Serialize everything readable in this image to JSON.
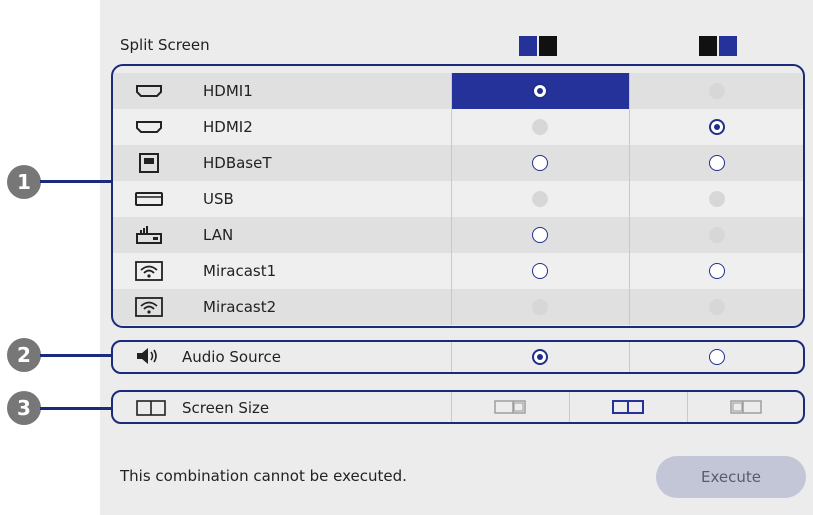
{
  "header": {
    "title": "Split Screen",
    "left_layout_icon": "left-active-layout-icon",
    "right_layout_icon": "right-active-layout-icon"
  },
  "sources": [
    {
      "label": "HDMI1",
      "icon": "hdmi-icon",
      "left": "selected",
      "right": "disabled"
    },
    {
      "label": "HDMI2",
      "icon": "hdmi-icon",
      "left": "disabled",
      "right": "checked"
    },
    {
      "label": "HDBaseT",
      "icon": "hdbaset-icon",
      "left": "unchecked",
      "right": "unchecked"
    },
    {
      "label": "USB",
      "icon": "usb-icon",
      "left": "disabled",
      "right": "disabled"
    },
    {
      "label": "LAN",
      "icon": "lan-icon",
      "left": "unchecked",
      "right": "disabled"
    },
    {
      "label": "Miracast1",
      "icon": "wifi-icon",
      "left": "unchecked",
      "right": "unchecked"
    },
    {
      "label": "Miracast2",
      "icon": "wifi-icon",
      "left": "disabled",
      "right": "disabled"
    }
  ],
  "audio": {
    "label": "Audio Source",
    "icon": "speaker-icon",
    "left": "checked",
    "right": "unchecked"
  },
  "screen_size": {
    "label": "Screen Size",
    "icon": "screen-size-icon",
    "options": [
      "left-large",
      "equal",
      "right-large"
    ],
    "selected": "equal"
  },
  "callouts": [
    "1",
    "2",
    "3"
  ],
  "footer": {
    "message": "This combination cannot be executed.",
    "execute_label": "Execute"
  },
  "colors": {
    "accent": "#25329a",
    "frame": "#1b2a7a",
    "disabled": "#d7d7d7"
  }
}
